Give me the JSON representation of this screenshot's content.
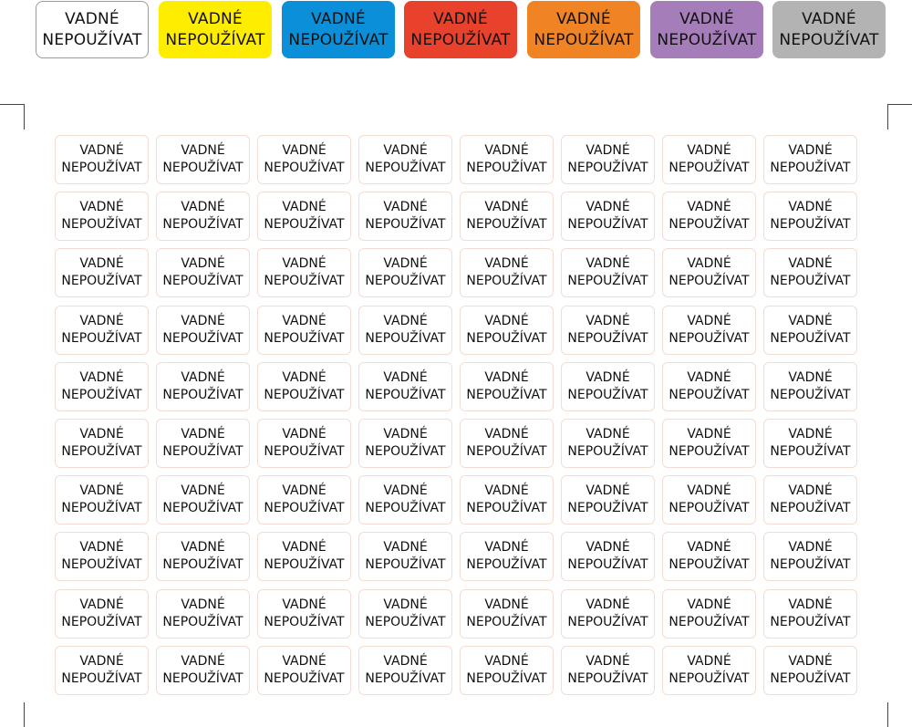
{
  "swatches": [
    {
      "line1": "VADNÉ",
      "line2": "NEPOUŽÍVAT",
      "color": "#ffffff",
      "outlined": true
    },
    {
      "line1": "VADNÉ",
      "line2": "NEPOUŽÍVAT",
      "color": "#ffed00"
    },
    {
      "line1": "VADNÉ",
      "line2": "NEPOUŽÍVAT",
      "color": "#0a8fd8"
    },
    {
      "line1": "VADNÉ",
      "line2": "NEPOUŽÍVAT",
      "color": "#e8412c"
    },
    {
      "line1": "VADNÉ",
      "line2": "NEPOUŽÍVAT",
      "color": "#f08323"
    },
    {
      "line1": "VADNÉ",
      "line2": "NEPOUŽÍVAT",
      "color": "#a57db8"
    },
    {
      "line1": "VADNÉ",
      "line2": "NEPOUŽÍVAT",
      "color": "#b3b3b3"
    }
  ],
  "labels": {
    "rows": 10,
    "cols": 8,
    "line1": "VADNÉ",
    "line2": "NEPOUŽÍVAT",
    "border_color": "#f2ddd2"
  }
}
